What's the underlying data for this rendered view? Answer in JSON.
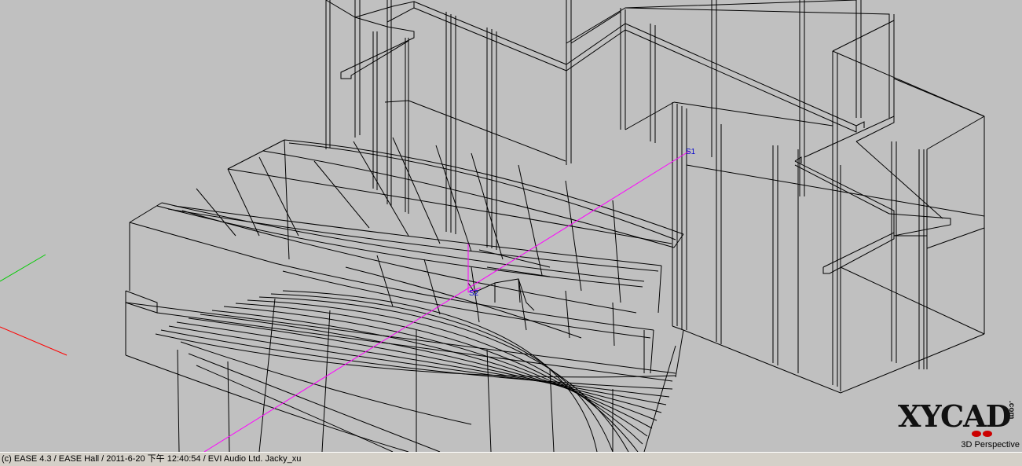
{
  "viewport": {
    "view_mode": "3D Perspective",
    "markers": {
      "source_label": "S1",
      "receiver_label": "S2"
    },
    "colors": {
      "background": "#c0c0c0",
      "wireframe": "#000000",
      "source_line": "#ff00ff",
      "axis_x": "#ff0000",
      "axis_y": "#00cc00",
      "axis_z": "#0000ff"
    }
  },
  "logo": {
    "text": "XYCAD",
    "suffix": ".com"
  },
  "status_bar": {
    "text": "(c) EASE 4.3  / EASE Hall  / 2011-6-20 下午 12:40:54 / EVI Audio Ltd. Jacky_xu"
  }
}
